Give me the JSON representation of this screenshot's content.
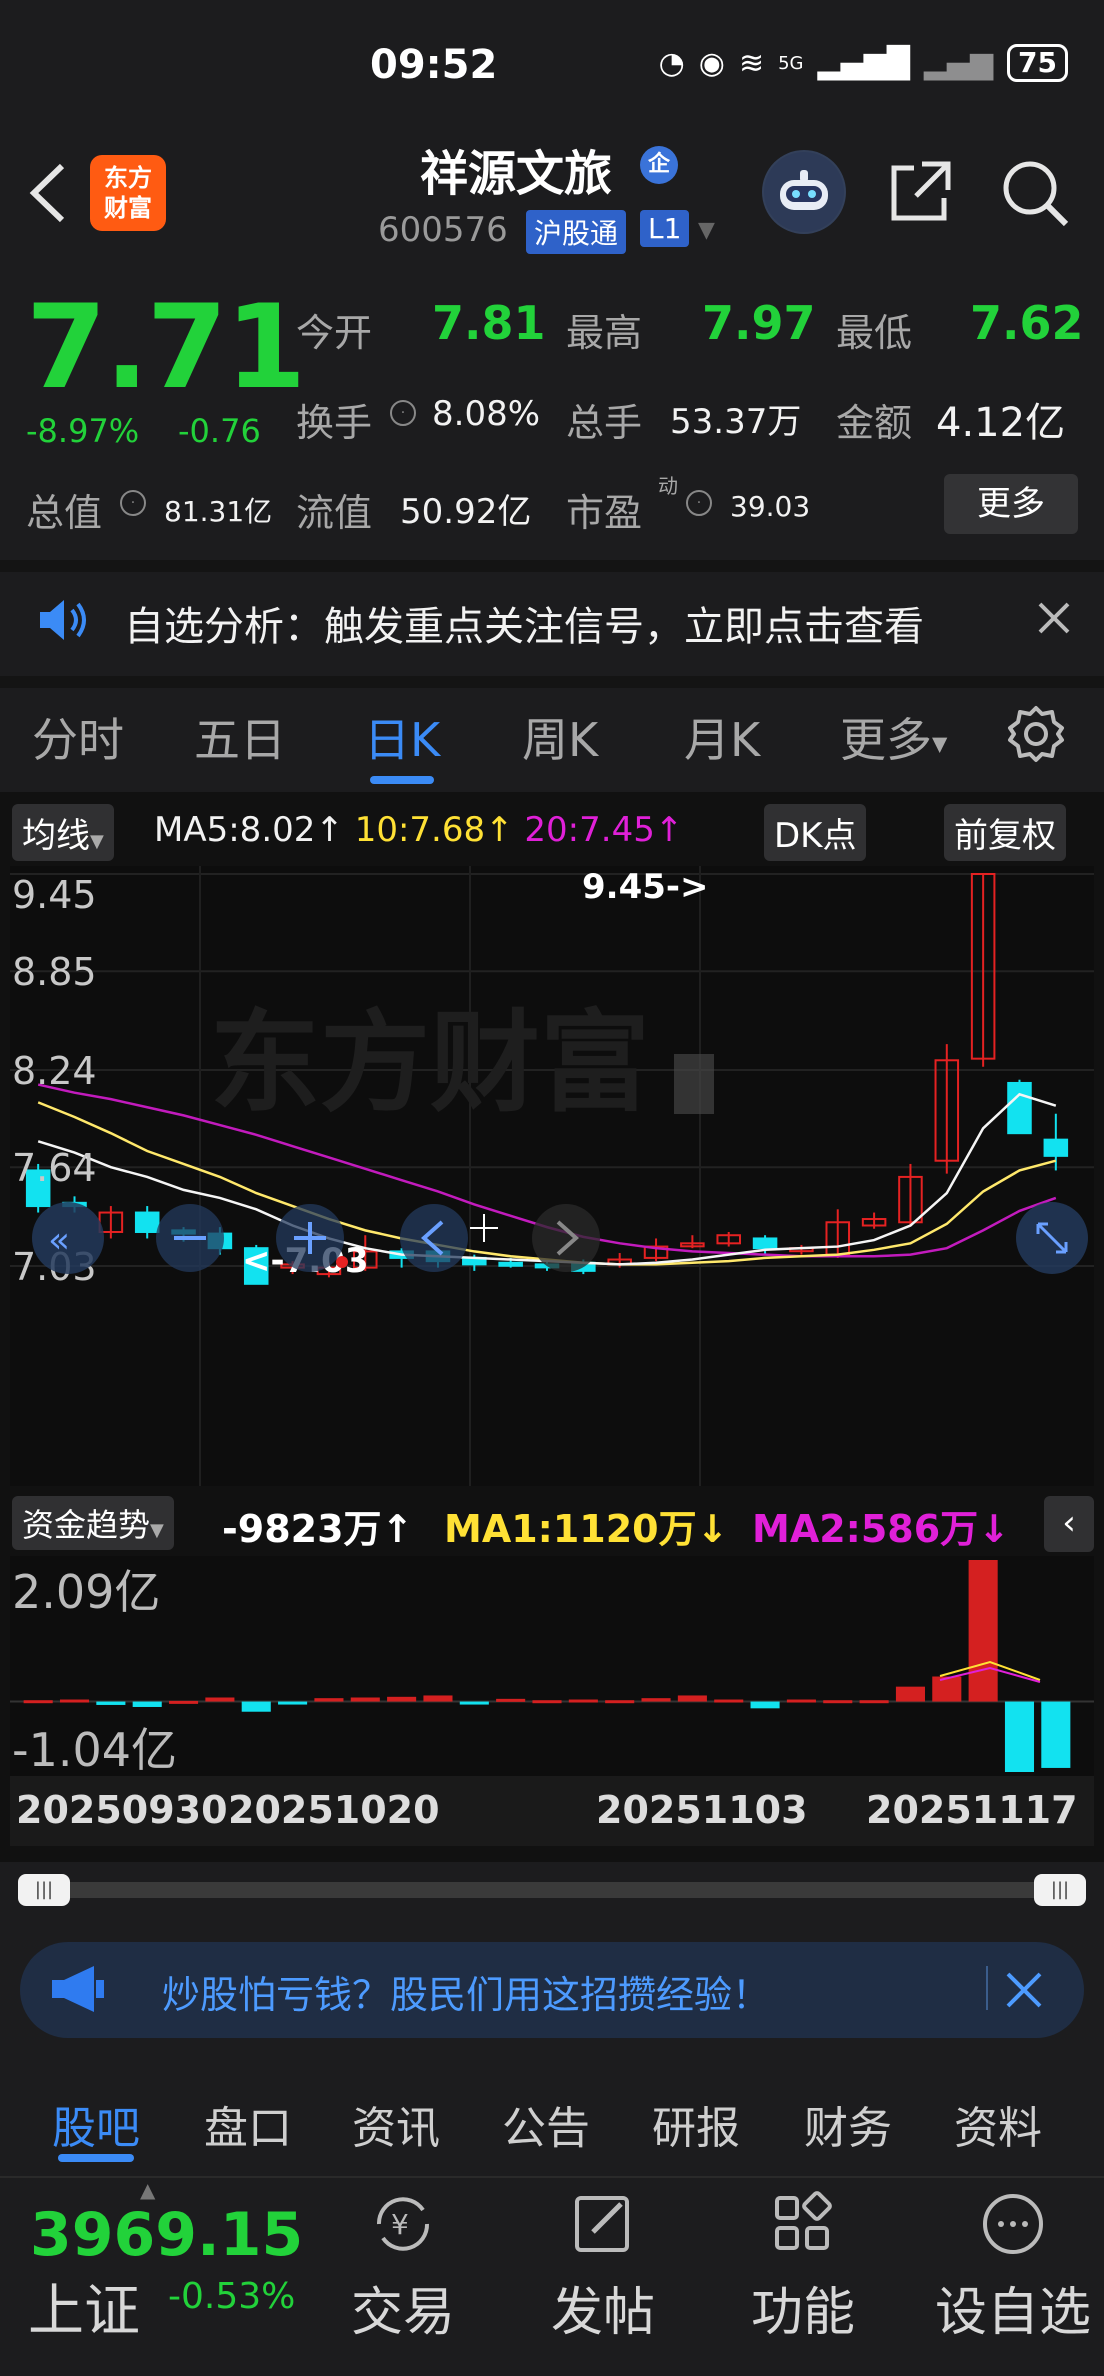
{
  "status": {
    "time": "09:52",
    "battery": "75",
    "net": "5G"
  },
  "header": {
    "logo_text": "东方财富",
    "stock_name": "祥源文旅",
    "corp_badge": "企",
    "stock_code": "600576",
    "hgt": "沪股通",
    "level": "L1"
  },
  "quote": {
    "price": "7.71",
    "pct": "-8.97%",
    "change": "-0.76",
    "open_label": "今开",
    "open": "7.81",
    "high_label": "最高",
    "high": "7.97",
    "low_label": "最低",
    "low": "7.62",
    "turnover_label": "换手",
    "turnover": "8.08%",
    "volume_label": "总手",
    "volume": "53.37万",
    "amount_label": "金额",
    "amount": "4.12亿",
    "mcap_label": "总值",
    "mcap": "81.31亿",
    "float_label": "流值",
    "float": "50.92亿",
    "pe_label": "市盈",
    "pe_sup": "动",
    "pe": "39.03",
    "more": "更多"
  },
  "notice": {
    "text": "自选分析：触发重点关注信号，立即点击查看"
  },
  "tabs": [
    "分时",
    "五日",
    "日K",
    "周K",
    "月K",
    "更多"
  ],
  "toolbar": {
    "ma_btn": "均线",
    "ma5": "MA5:8.02↑",
    "ma10": "10:7.68↑",
    "ma20": "20:7.45↑",
    "dk": "DK点",
    "adjust": "前复权"
  },
  "main_chart": {
    "y_labels": [
      "9.45",
      "8.85",
      "8.24",
      "7.64",
      "7.03"
    ],
    "max_marker": "9.45->",
    "min_marker": "<-7.03",
    "watermark": "东方财富"
  },
  "sub_chart": {
    "label": "资金趋势",
    "value": "-9823万↑",
    "ma1": "MA1:1120万↓",
    "ma2": "MA2:586万↓",
    "y_top": "2.09亿",
    "y_bottom": "-1.04亿"
  },
  "dates": [
    "20250930",
    "20251020",
    "20251103",
    "20251117"
  ],
  "ad": {
    "text": "炒股怕亏钱？股民们用这招攒经验！"
  },
  "bottom_tabs": [
    "股吧",
    "盘口",
    "资讯",
    "公告",
    "研报",
    "财务",
    "资料"
  ],
  "index": {
    "value": "3969.15",
    "name": "上证",
    "pct": "-0.53%"
  },
  "nav": [
    {
      "label": "交易",
      "icon": "trade-icon"
    },
    {
      "label": "发帖",
      "icon": "post-icon"
    },
    {
      "label": "功能",
      "icon": "apps-icon"
    },
    {
      "label": "设自选",
      "icon": "add-watchlist-icon"
    }
  ],
  "colors": {
    "up": "#e52222",
    "down": "#12e2f0",
    "accent": "#3b8bf6",
    "fall_text": "#22d23a"
  },
  "chart_data": {
    "type": "candlestick",
    "y_range": [
      7.03,
      9.45
    ],
    "candles": [
      {
        "o": 7.62,
        "c": 7.4,
        "h": 7.66,
        "l": 7.36
      },
      {
        "o": 7.42,
        "c": 7.4,
        "h": 7.46,
        "l": 7.36
      },
      {
        "o": 7.24,
        "c": 7.36,
        "h": 7.4,
        "l": 7.2
      },
      {
        "o": 7.36,
        "c": 7.24,
        "h": 7.4,
        "l": 7.2
      },
      {
        "o": 7.25,
        "c": 7.23,
        "h": 7.27,
        "l": 7.18
      },
      {
        "o": 7.23,
        "c": 7.14,
        "h": 7.27,
        "l": 7.1
      },
      {
        "o": 7.14,
        "c": 6.92,
        "h": 7.16,
        "l": 6.9
      },
      {
        "o": 7.02,
        "c": 7.04,
        "h": 7.06,
        "l": 6.98
      },
      {
        "o": 6.98,
        "c": 7.02,
        "h": 7.05,
        "l": 6.96
      },
      {
        "o": 7.02,
        "c": 7.12,
        "h": 7.22,
        "l": 7.0
      },
      {
        "o": 7.12,
        "c": 7.08,
        "h": 7.14,
        "l": 7.02
      },
      {
        "o": 7.12,
        "c": 7.06,
        "h": 7.14,
        "l": 7.02
      },
      {
        "o": 7.08,
        "c": 7.04,
        "h": 7.1,
        "l": 7.0
      },
      {
        "o": 7.05,
        "c": 7.04,
        "h": 7.08,
        "l": 7.02
      },
      {
        "o": 7.04,
        "c": 7.03,
        "h": 7.06,
        "l": 7.0
      },
      {
        "o": 7.05,
        "c": 7.0,
        "h": 7.07,
        "l": 6.98
      },
      {
        "o": 7.04,
        "c": 7.07,
        "h": 7.11,
        "l": 7.02
      },
      {
        "o": 7.08,
        "c": 7.15,
        "h": 7.2,
        "l": 7.06
      },
      {
        "o": 7.17,
        "c": 7.17,
        "h": 7.22,
        "l": 7.14
      },
      {
        "o": 7.17,
        "c": 7.22,
        "h": 7.24,
        "l": 7.15
      },
      {
        "o": 7.2,
        "c": 7.14,
        "h": 7.22,
        "l": 7.1
      },
      {
        "o": 7.13,
        "c": 7.14,
        "h": 7.16,
        "l": 7.1
      },
      {
        "o": 7.1,
        "c": 7.3,
        "h": 7.38,
        "l": 7.08
      },
      {
        "o": 7.28,
        "c": 7.32,
        "h": 7.36,
        "l": 7.26
      },
      {
        "o": 7.3,
        "c": 7.58,
        "h": 7.66,
        "l": 7.28
      },
      {
        "o": 7.68,
        "c": 8.3,
        "h": 8.4,
        "l": 7.6
      },
      {
        "o": 8.31,
        "c": 9.45,
        "h": 9.45,
        "l": 8.26
      },
      {
        "o": 8.16,
        "c": 7.85,
        "h": 8.18,
        "l": 7.85
      },
      {
        "o": 7.81,
        "c": 7.71,
        "h": 7.97,
        "l": 7.62
      }
    ],
    "ma5": [
      7.8,
      7.73,
      7.64,
      7.58,
      7.5,
      7.45,
      7.38,
      7.28,
      7.2,
      7.14,
      7.1,
      7.09,
      7.08,
      7.07,
      7.06,
      7.05,
      7.04,
      7.05,
      7.07,
      7.1,
      7.13,
      7.14,
      7.15,
      7.19,
      7.28,
      7.48,
      7.88,
      8.09,
      8.02
    ],
    "ma10": [
      8.04,
      7.95,
      7.85,
      7.74,
      7.66,
      7.58,
      7.48,
      7.4,
      7.32,
      7.25,
      7.2,
      7.16,
      7.12,
      7.09,
      7.07,
      7.05,
      7.04,
      7.04,
      7.05,
      7.06,
      7.08,
      7.09,
      7.1,
      7.13,
      7.17,
      7.29,
      7.49,
      7.62,
      7.68
    ],
    "ma20": [
      8.15,
      8.1,
      8.06,
      8.01,
      7.96,
      7.9,
      7.84,
      7.77,
      7.7,
      7.63,
      7.56,
      7.49,
      7.41,
      7.34,
      7.27,
      7.21,
      7.17,
      7.14,
      7.12,
      7.11,
      7.1,
      7.09,
      7.09,
      7.09,
      7.1,
      7.14,
      7.25,
      7.37,
      7.45
    ],
    "fund_flow": {
      "y_range": [
        -1.04,
        2.09
      ],
      "values": [
        0.02,
        0.03,
        -0.05,
        -0.08,
        0.01,
        0.06,
        -0.15,
        -0.02,
        0.05,
        0.06,
        0.07,
        0.09,
        -0.04,
        0.04,
        0.02,
        0.03,
        0.02,
        0.05,
        0.09,
        0.03,
        -0.1,
        0.03,
        0.02,
        0.02,
        0.22,
        0.37,
        2.09,
        -1.04,
        -0.98
      ]
    }
  }
}
